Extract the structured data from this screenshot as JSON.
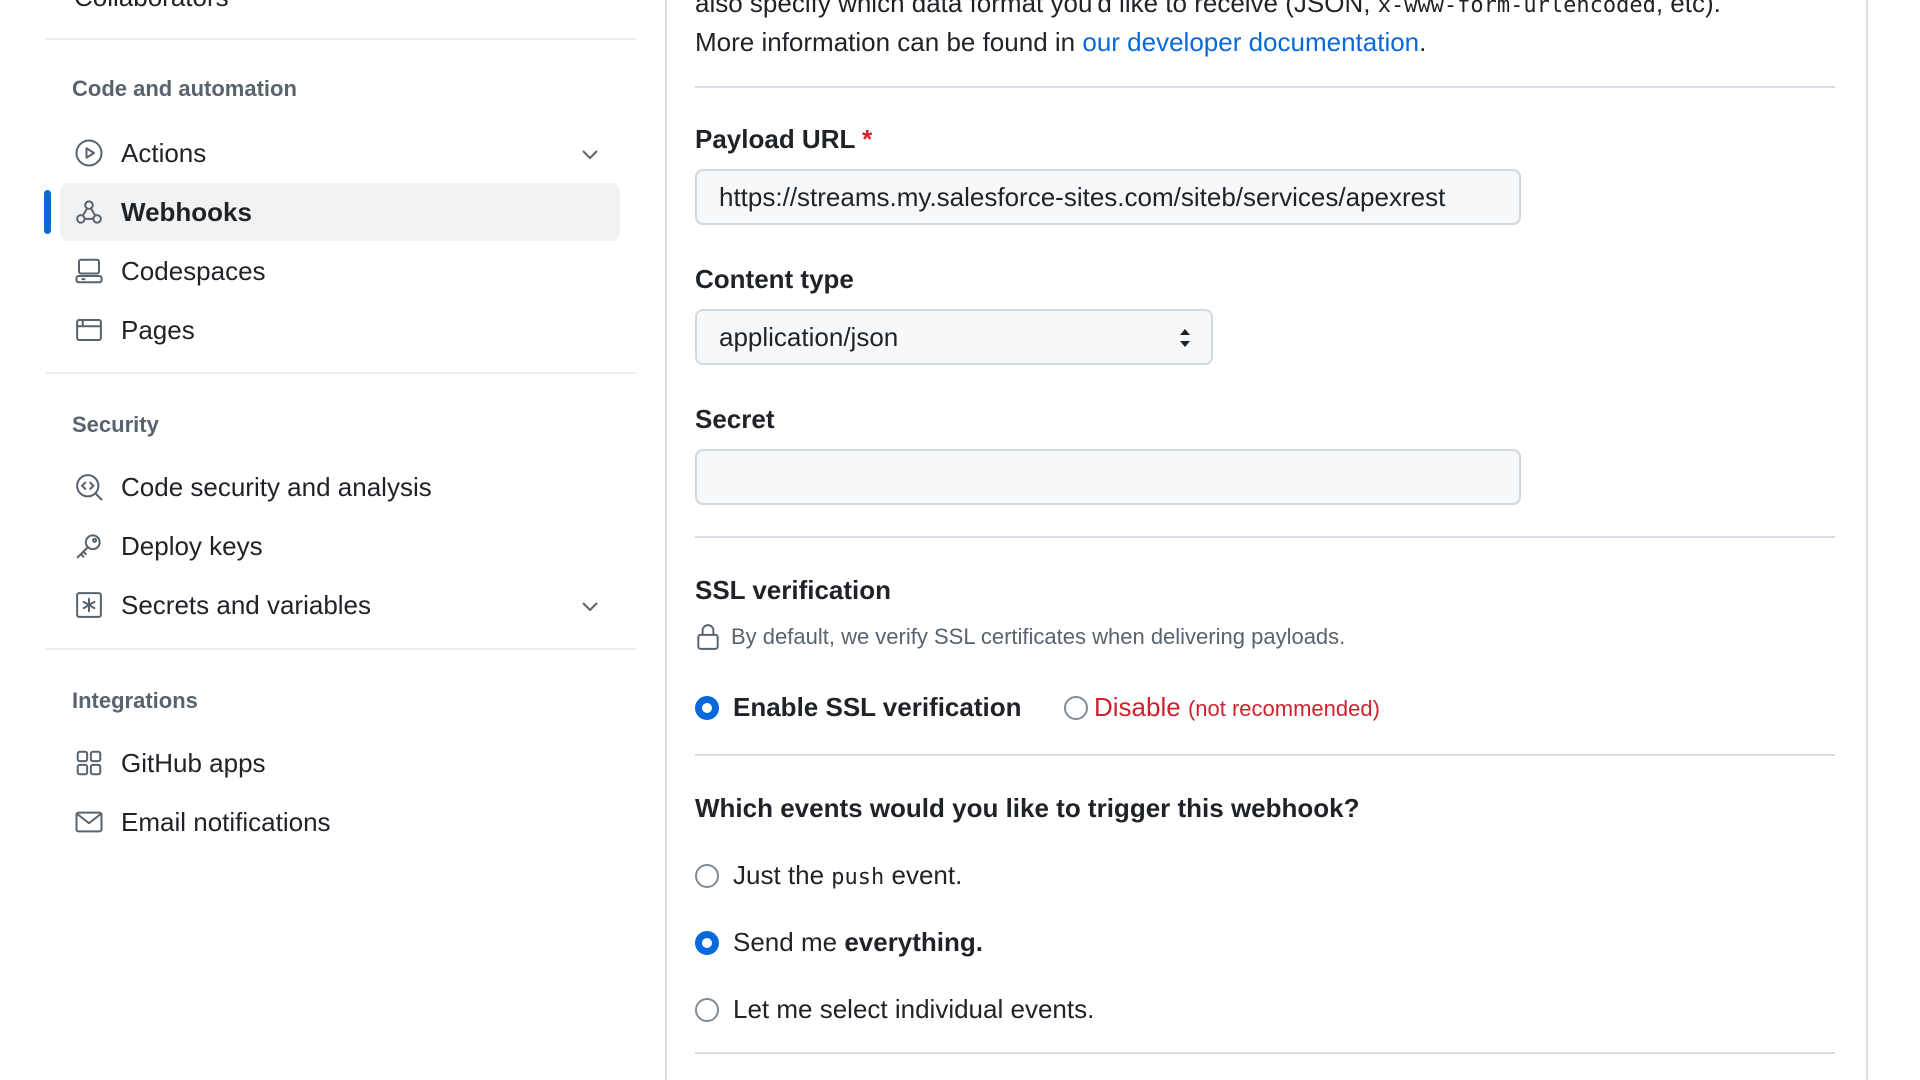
{
  "sidebar": {
    "cutoff_item_label": "Collaborators",
    "sections": {
      "code_automation": "Code and automation",
      "security": "Security",
      "integrations": "Integrations"
    },
    "items": {
      "actions": {
        "label": "Actions",
        "icon": "play-icon"
      },
      "webhooks": {
        "label": "Webhooks",
        "icon": "webhook-icon",
        "active": true
      },
      "codespaces": {
        "label": "Codespaces",
        "icon": "codespaces-icon"
      },
      "pages": {
        "label": "Pages",
        "icon": "browser-icon"
      },
      "code_security": {
        "label": "Code security and analysis",
        "icon": "codescan-icon"
      },
      "deploy_keys": {
        "label": "Deploy keys",
        "icon": "key-icon"
      },
      "secrets": {
        "label": "Secrets and variables",
        "icon": "asterisk-icon"
      },
      "github_apps": {
        "label": "GitHub apps",
        "icon": "apps-icon"
      },
      "email_notifications": {
        "label": "Email notifications",
        "icon": "mail-icon"
      }
    }
  },
  "form": {
    "intro_line1_text": "also specify which data format you'd like to receive (JSON,",
    "intro_line1_code": "x-www-form-urlencoded",
    "intro_line1_tail": ", etc).",
    "intro_line2_prefix": "More information can be found in",
    "intro_link": "our developer documentation",
    "intro_line2_suffix": ".",
    "payload_url": {
      "label": "Payload URL",
      "required_marker": "*",
      "value": "https://streams.my.salesforce-sites.com/siteb/services/apexrest"
    },
    "content_type": {
      "label": "Content type",
      "value": "application/json"
    },
    "secret": {
      "label": "Secret",
      "value": ""
    },
    "ssl": {
      "heading": "SSL verification",
      "description": "By default, we verify SSL certificates when delivering payloads.",
      "enable_label": "Enable SSL verification",
      "disable_label": "Disable",
      "disable_note": "(not recommended)",
      "selected": "enable"
    },
    "events": {
      "question": "Which events would you like to trigger this webhook?",
      "just_push_prefix": "Just the",
      "just_push_code": "push",
      "just_push_suffix": "event.",
      "everything_prefix": "Send me",
      "everything_bold": "everything.",
      "individual": "Let me select individual events.",
      "selected": "everything"
    }
  },
  "colors": {
    "accent": "#0969da",
    "danger": "#cf222e",
    "muted": "#59636e",
    "border": "#d1d9e0"
  }
}
